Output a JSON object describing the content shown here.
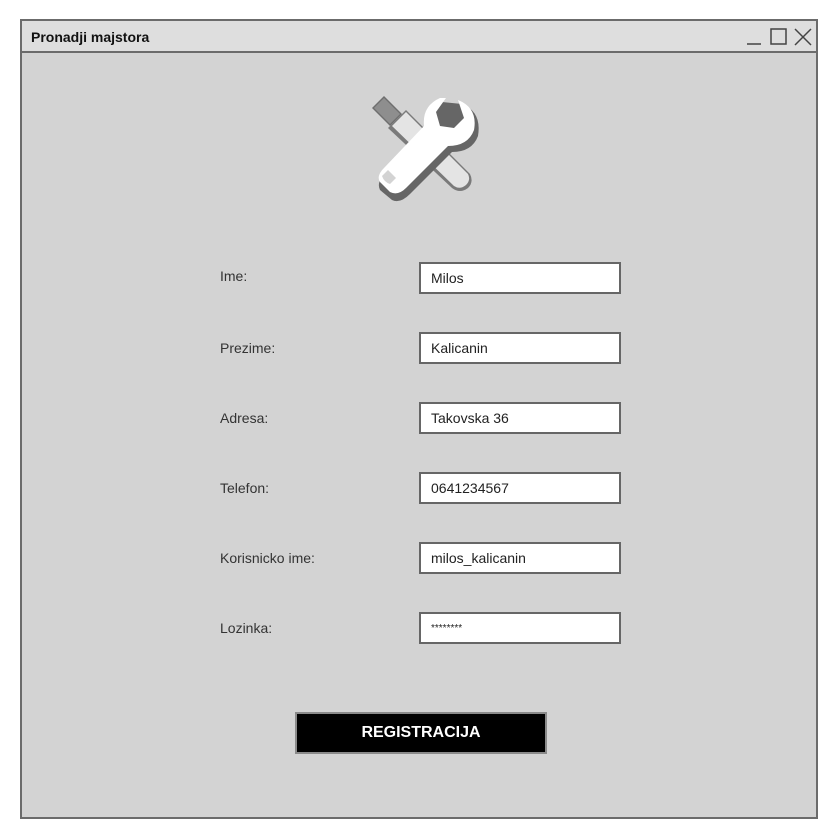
{
  "window": {
    "title": "Pronadji majstora"
  },
  "logo": {
    "icon": "tools-icon"
  },
  "form": {
    "fields": [
      {
        "label": "Ime:",
        "value": "Milos"
      },
      {
        "label": "Prezime:",
        "value": "Kalicanin"
      },
      {
        "label": "Adresa:",
        "value": "Takovska 36"
      },
      {
        "label": "Telefon:",
        "value": "0641234567"
      },
      {
        "label": "Korisnicko ime:",
        "value": "milos_kalicanin"
      },
      {
        "label": "Lozinka:",
        "value": "********"
      }
    ],
    "submit_label": "REGISTRACIJA"
  },
  "colors": {
    "window_bg": "#d3d3d3",
    "titlebar_bg": "#dedede",
    "border": "#6b6b6b",
    "button_bg": "#000000",
    "button_text": "#ffffff"
  }
}
